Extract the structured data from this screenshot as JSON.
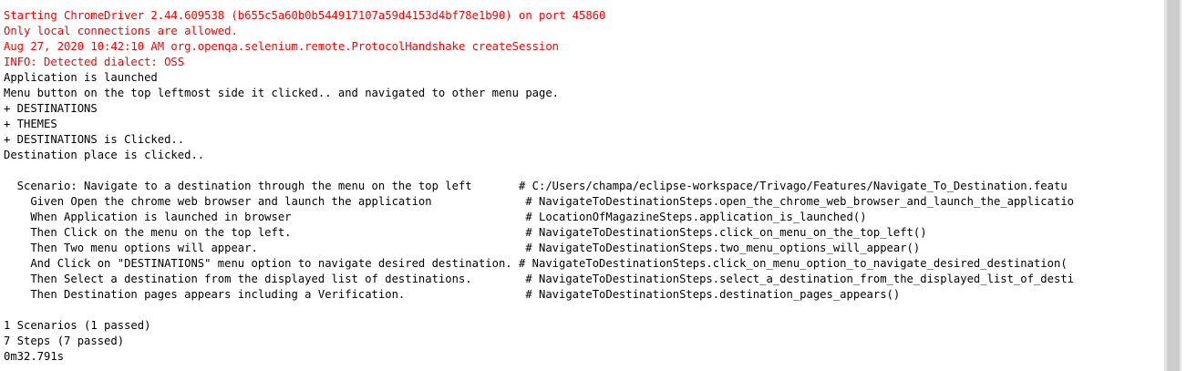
{
  "console": {
    "lines": [
      {
        "text": "Starting ChromeDriver 2.44.609538 (b655c5a60b0b544917107a59d4153d4bf78e1b90) on port 45860",
        "kind": "err"
      },
      {
        "text": "Only local connections are allowed.",
        "kind": "err"
      },
      {
        "text": "Aug 27, 2020 10:42:10 AM org.openqa.selenium.remote.ProtocolHandshake createSession",
        "kind": "err"
      },
      {
        "text": "INFO: Detected dialect: OSS",
        "kind": "err"
      },
      {
        "text": "Application is launched",
        "kind": "out"
      },
      {
        "text": "Menu button on the top leftmost side it clicked.. and navigated to other menu page.",
        "kind": "out"
      },
      {
        "text": "+ DESTINATIONS",
        "kind": "out"
      },
      {
        "text": "+ THEMES",
        "kind": "out"
      },
      {
        "text": "+ DESTINATIONS is Clicked..",
        "kind": "out"
      },
      {
        "text": "Destination place is clicked..",
        "kind": "out"
      },
      {
        "text": "",
        "kind": "out"
      },
      {
        "text": "  Scenario: Navigate to a destination through the menu on the top left       # C:/Users/champa/eclipse-workspace/Trivago/Features/Navigate_To_Destination.featu",
        "kind": "out"
      },
      {
        "text": "    Given Open the chrome web browser and launch the application              # NavigateToDestinationSteps.open_the_chrome_web_browser_and_launch_the_applicatio",
        "kind": "out"
      },
      {
        "text": "    When Application is launched in browser                                   # LocationOfMagazineSteps.application_is_launched()",
        "kind": "out"
      },
      {
        "text": "    Then Click on the menu on the top left.                                   # NavigateToDestinationSteps.click_on_menu_on_the_top_left()",
        "kind": "out"
      },
      {
        "text": "    Then Two menu options will appear.                                        # NavigateToDestinationSteps.two_menu_options_will_appear()",
        "kind": "out"
      },
      {
        "text": "    And Click on \"DESTINATIONS\" menu option to navigate desired destination. # NavigateToDestinationSteps.click_on_menu_option_to_navigate_desired_destination(",
        "kind": "out"
      },
      {
        "text": "    Then Select a destination from the displayed list of destinations.        # NavigateToDestinationSteps.select_a_destination_from_the_displayed_list_of_desti",
        "kind": "out"
      },
      {
        "text": "    Then Destination pages appears including a Verification.                  # NavigateToDestinationSteps.destination_pages_appears()",
        "kind": "out"
      },
      {
        "text": "",
        "kind": "out"
      },
      {
        "text": "1 Scenarios (1 passed)",
        "kind": "out"
      },
      {
        "text": "7 Steps (7 passed)",
        "kind": "out"
      },
      {
        "text": "0m32.791s",
        "kind": "out"
      }
    ]
  },
  "colors": {
    "stderr": "#ff0000",
    "stdout": "#000000",
    "background": "#ffffff",
    "scrollbar_track": "#e6e6e6",
    "scrollbar_thumb": "#cdcdcd"
  }
}
